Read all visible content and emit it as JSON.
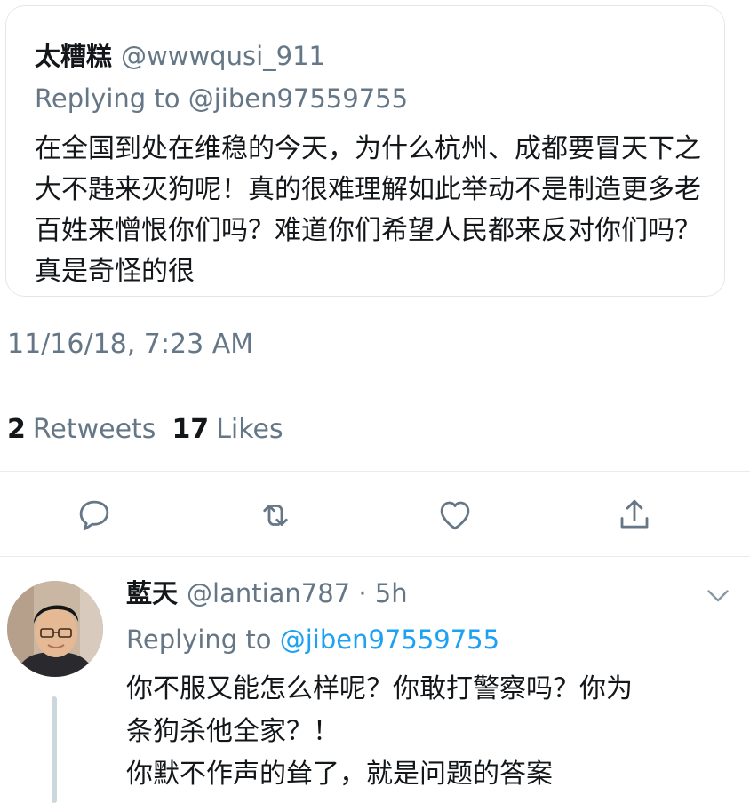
{
  "quoted_tweet": {
    "display_name": "太糟糕",
    "handle": "@wwwqusi_911",
    "replying_to": "Replying to @jiben97559755",
    "text": "在全国到处在维稳的今天，为什么杭州、成都要冒天下之大不韪来灭狗呢！真的很难理解如此举动不是制造更多老百姓来憎恨你们吗？难道你们希望人民都来反对你们吗？真是奇怪的很"
  },
  "timestamp": "11/16/18, 7:23 AM",
  "stats": {
    "retweets_count": "2",
    "retweets_label": "Retweets",
    "likes_count": "17",
    "likes_label": "Likes"
  },
  "actions": {
    "reply_icon": "reply-icon",
    "retweet_icon": "retweet-icon",
    "like_icon": "heart-icon",
    "share_icon": "share-icon"
  },
  "reply_tweet": {
    "display_name": "藍天",
    "handle": "@lantian787 · 5h",
    "replying_prefix": "Replying to",
    "replying_mention": "@jiben97559755",
    "lines": [
      "你不服又能怎么样呢？你敢打警察吗？你为",
      "条狗杀他全家？！",
      "你默不作声的耸了，就是问题的答案"
    ]
  },
  "colors": {
    "primary_text": "#14171a",
    "secondary_text": "#657786",
    "link": "#1da1f2",
    "border": "#e1e8ed"
  }
}
